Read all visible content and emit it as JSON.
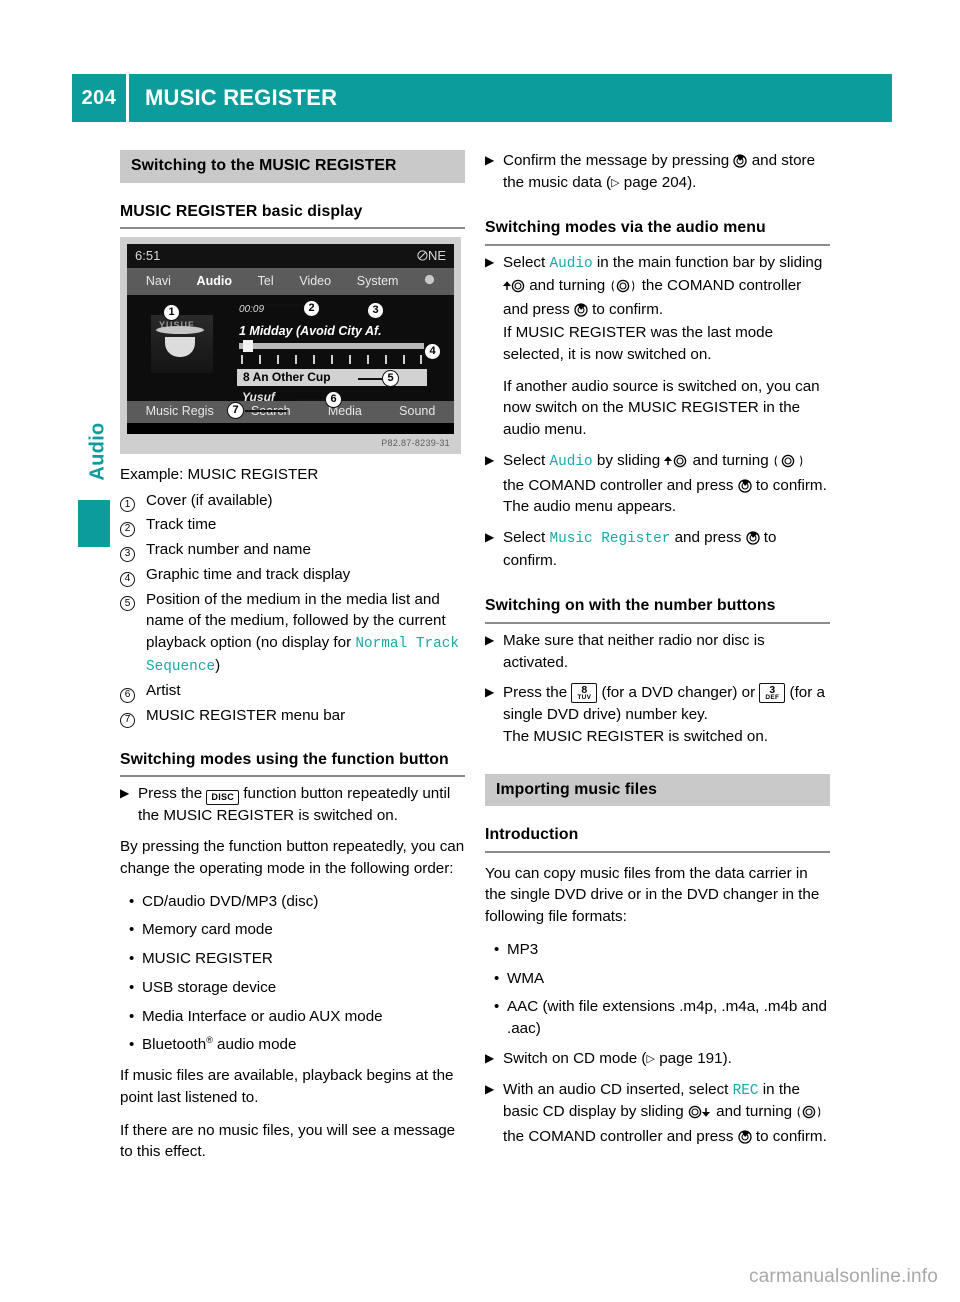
{
  "header": {
    "page_number": "204",
    "title": "MUSIC REGISTER"
  },
  "side_tab": {
    "label": "Audio",
    "accent_color": "#0d9c9c"
  },
  "watermark": "carmanualsonline.info",
  "left_column": {
    "section_heading": "Switching to the MUSIC REGISTER",
    "subheading_basic_display": "MUSIC REGISTER basic display",
    "figure": {
      "caption": "Example: MUSIC REGISTER",
      "code": "P82.87-8239-31",
      "status_time": "6:51",
      "status_compass": "NE",
      "menu_items": [
        "Navi",
        "Audio",
        "Tel",
        "Video",
        "System"
      ],
      "selected_menu": "Audio",
      "track_time": "00:09",
      "track_title": "1 Midday (Avoid City Af.",
      "medium_name": "8 An Other Cup",
      "artist": "Yusuf",
      "cover_word": "YUSUF",
      "bottom_items": [
        "Music Regis",
        "Search",
        "Media",
        "Sound"
      ],
      "callouts": [
        "1",
        "2",
        "3",
        "4",
        "5",
        "6",
        "7"
      ]
    },
    "legend": [
      {
        "num": "1",
        "text": "Cover (if available)"
      },
      {
        "num": "2",
        "text": "Track time"
      },
      {
        "num": "3",
        "text": "Track number and name"
      },
      {
        "num": "4",
        "text": "Graphic time and track display"
      },
      {
        "num": "5",
        "text": "Position of the medium in the media list and name of the medium, followed by the current playback option (no display for ",
        "mono": "Normal Track Sequence",
        "text_after": ")"
      },
      {
        "num": "6",
        "text": "Artist"
      },
      {
        "num": "7",
        "text": "MUSIC REGISTER menu bar"
      }
    ],
    "subheading_function_button": "Switching modes using the function button",
    "step_disc_pre": "Press the",
    "step_disc_key": "DISC",
    "step_disc_post": "function button repeatedly until the MUSIC REGISTER is switched on.",
    "para_order": "By pressing the function button repeatedly, you can change the operating mode in the following order:",
    "mode_list": [
      "CD/audio DVD/MP3 (disc)",
      "Memory card mode",
      "MUSIC REGISTER",
      "USB storage device",
      "Media Interface or audio AUX mode"
    ],
    "mode_list_bluetooth_pre": "Bluetooth",
    "mode_list_bluetooth_sup": "®",
    "mode_list_bluetooth_post": " audio mode",
    "para_playback": "If music files are available, playback begins at the point last listened to.",
    "para_nofiles": "If there are no music files, you will see a message to this effect."
  },
  "right_column": {
    "step_confirm_pre": "Confirm the message by pressing",
    "step_confirm_mid": "and store the music data (",
    "step_confirm_ref": "page 204",
    "step_confirm_post": ").",
    "subheading_audio_menu": "Switching modes via the audio menu",
    "step_select_audio_1_pre": "Select",
    "step_select_audio_1_term": "Audio",
    "step_select_audio_1_mid1": "in the main function bar by sliding",
    "step_select_audio_1_mid2": "and turning",
    "step_select_audio_1_mid3": "the COMAND controller and press",
    "step_select_audio_1_end": "to confirm.",
    "para_last_mode": "If MUSIC REGISTER was the last mode selected, it is now switched on.",
    "para_another_source": "If another audio source is switched on, you can now switch on the MUSIC REGISTER in the audio menu.",
    "step_select_audio_2_pre": "Select",
    "step_select_audio_2_term": "Audio",
    "step_select_audio_2_mid1": "by sliding",
    "step_select_audio_2_mid2": "and turning",
    "step_select_audio_2_mid3": "the COMAND controller and press",
    "step_select_audio_2_end": "to confirm.",
    "para_audio_menu_appears": "The audio menu appears.",
    "step_music_register_pre": "Select",
    "step_music_register_term": "Music Register",
    "step_music_register_mid": "and press",
    "step_music_register_post": "to confirm.",
    "subheading_number_buttons": "Switching on with the number buttons",
    "step_make_sure": "Make sure that neither radio nor disc is activated.",
    "step_press_pre": "Press the",
    "key_8_num": "8",
    "key_8_sub": "TUV",
    "step_press_mid": "(for a DVD changer) or",
    "key_3_num": "3",
    "key_3_sub": "DEF",
    "step_press_post": "(for a single DVD drive) number key.",
    "para_switched_on": "The MUSIC REGISTER is switched on.",
    "section_heading_importing": "Importing music files",
    "subheading_introduction": "Introduction",
    "para_copy": "You can copy music files from the data carrier in the single DVD drive or in the DVD changer in the following file formats:",
    "format_list": [
      "MP3",
      "WMA",
      "AAC (with file extensions .m4p, .m4a, .m4b and .aac)"
    ],
    "step_cd_mode_pre": "Switch on CD mode (",
    "step_cd_mode_ref": "page 191",
    "step_cd_mode_post": ").",
    "step_rec_pre": "With an audio CD inserted, select",
    "step_rec_term": "REC",
    "step_rec_mid1": "in the basic CD display by sliding",
    "step_rec_mid2": "and turning",
    "step_rec_mid3": "the COMAND controller and press",
    "step_rec_end": "to confirm."
  }
}
